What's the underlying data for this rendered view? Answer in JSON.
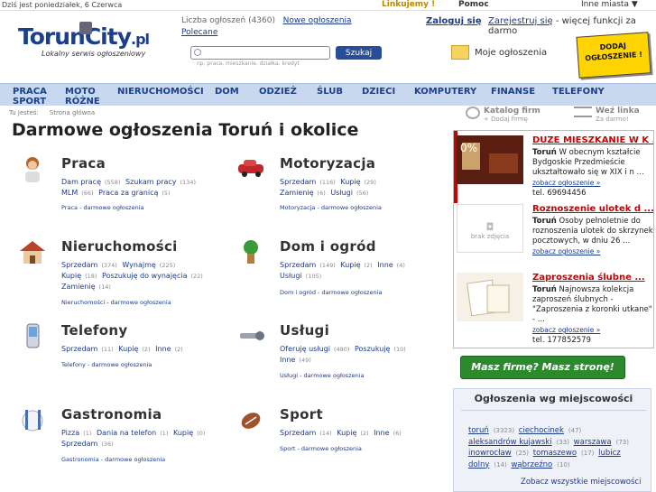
{
  "topbar": {
    "date": "Dziś jest poniedziałek, 6 Czerwca",
    "link_us": "Linkujemy !",
    "help": "Pomoc",
    "cities": "Inne miasta ▼"
  },
  "logo": {
    "name": "TorunCity",
    "suffix": ".pl",
    "tagline": "Lokalny serwis ogłoszeniowy"
  },
  "header": {
    "count_label": "Liczba ogłoszeń (4360)",
    "new_ads": "Nowe ogłoszenia",
    "recommended": "Polecane",
    "login": "Zaloguj się",
    "register": "Zarejestruj się",
    "register_suffix": " - więcej funkcji za darmo",
    "my_ads": "Moje ogłoszenia",
    "add_ad_line1": "DODAJ",
    "add_ad_line2": "OGŁOSZENIE !"
  },
  "search": {
    "placeholder": "",
    "button": "Szukaj",
    "hint": "np. praca, mieszkanie, działka, kredyt"
  },
  "nav": [
    "PRACA",
    "MOTO",
    "NIERUCHOMOŚCI",
    "DOM",
    "ODZIEŻ",
    "ŚLUB",
    "DZIECI",
    "KOMPUTERY",
    "FINANSE",
    "TELEFONY",
    "SPORT",
    "RÓŻNE"
  ],
  "breadcrumb": {
    "label": "Tu jesteś:",
    "current": "Strona główna"
  },
  "tools": {
    "catalog": "Katalog firm",
    "catalog_sub": "+ Dodaj firmę",
    "exchange": "Weź linka",
    "exchange_sub": "Za darmo!"
  },
  "page_title": "Darmowe ogłoszenia Toruń i okolice",
  "categories": {
    "praca": {
      "title": "Praca",
      "l1": "Dam pracę",
      "c1": "(558)",
      "l2": "Szukam pracy",
      "c2": "(134)",
      "l3": "MLM",
      "c3": "(66)",
      "l4": "Praca za granicą",
      "c4": "(5)",
      "foot": "Praca - darmowe ogłoszenia"
    },
    "moto": {
      "title": "Motoryzacja",
      "l1": "Sprzedam",
      "c1": "(116)",
      "l2": "Kupię",
      "c2": "(29)",
      "l3": "Zamienię",
      "c3": "(6)",
      "l4": "Usługi",
      "c4": "(56)",
      "foot": "Motoryzacja - darmowe ogłoszenia"
    },
    "nieruch": {
      "title": "Nieruchomości",
      "l1": "Sprzedam",
      "c1": "(374)",
      "l2": "Wynajmę",
      "c2": "(225)",
      "l3": "Kupię",
      "c3": "(18)",
      "l4": "Poszukuję do wynajęcia",
      "c4": "(22)",
      "l5": "Zamienię",
      "c5": "(14)",
      "foot": "Nieruchomości - darmowe ogłoszenia"
    },
    "dom": {
      "title": "Dom i ogród",
      "l1": "Sprzedam",
      "c1": "(149)",
      "l2": "Kupię",
      "c2": "(2)",
      "l3": "Inne",
      "c3": "(4)",
      "l4": "Usługi",
      "c4": "(105)",
      "foot": "Dom i ogród - darmowe ogłoszenia"
    },
    "tel": {
      "title": "Telefony",
      "l1": "Sprzedam",
      "c1": "(11)",
      "l2": "Kupię",
      "c2": "(2)",
      "l3": "Inne",
      "c3": "(2)",
      "foot": "Telefony - darmowe ogłoszenia"
    },
    "uslugi": {
      "title": "Usługi",
      "l1": "Oferuję usługi",
      "c1": "(480)",
      "l2": "Poszukuję",
      "c2": "(10)",
      "l3": "Inne",
      "c3": "(49)",
      "foot": "Usługi - darmowe ogłoszenia"
    },
    "gastro": {
      "title": "Gastronomia",
      "l1": "Pizza",
      "c1": "(1)",
      "l2": "Dania na telefon",
      "c2": "(1)",
      "l3": "Kupię",
      "c3": "(0)",
      "l4": "Sprzedam",
      "c4": "(36)",
      "foot": "Gastronomia - darmowe ogłoszenia"
    },
    "sport": {
      "title": "Sport",
      "l1": "Sprzedam",
      "c1": "(14)",
      "l2": "Kupię",
      "c2": "(2)",
      "l3": "Inne",
      "c3": "(6)",
      "foot": "Sport - darmowe ogłoszenia"
    }
  },
  "ads": [
    {
      "title": "DUŻE MIESZKANIE W K ...",
      "city": "Toruń",
      "text": "W obecnym kształcie Bydgoskie Przedmieście ukształtowało się w XIX i n ...",
      "more": "zobacz ogłoszenie »",
      "phone": "tel. 69694456"
    },
    {
      "title": "Roznoszenie ulotek d ...",
      "city": "Toruń",
      "text": "Osoby pełnoletnie do roznoszenia ulotek do skrzynek pocztowych, w dniu 26 ...",
      "more": "zobacz ogłoszenie »",
      "phone": "",
      "no_photo": "brak zdjęcia"
    },
    {
      "title": "Zaproszenia ślubne ...",
      "city": "Toruń",
      "text": "Najnowsza kolekcja zaproszeń ślubnych - \"Zaproszenia z koronki utkane\" - ...",
      "more": "zobacz ogłoszenie »",
      "phone": "tel. 177852579"
    }
  ],
  "cta": "Masz firmę? Masz stronę!",
  "local": {
    "heading": "Ogłoszenia wg miejscowości",
    "cities": [
      {
        "name": "toruń",
        "count": "(3323)"
      },
      {
        "name": "ciechocinek",
        "count": "(47)"
      },
      {
        "name": "aleksandrów kujawski",
        "count": "(33)"
      },
      {
        "name": "warszawa",
        "count": "(73)"
      },
      {
        "name": "inowrocław",
        "count": "(25)"
      },
      {
        "name": "tomaszewo",
        "count": "(17)"
      },
      {
        "name": "lubicz dolny",
        "count": "(14)"
      },
      {
        "name": "wąbrzeźno",
        "count": "(10)"
      }
    ],
    "all": "Zobacz wszystkie miejscowości"
  }
}
